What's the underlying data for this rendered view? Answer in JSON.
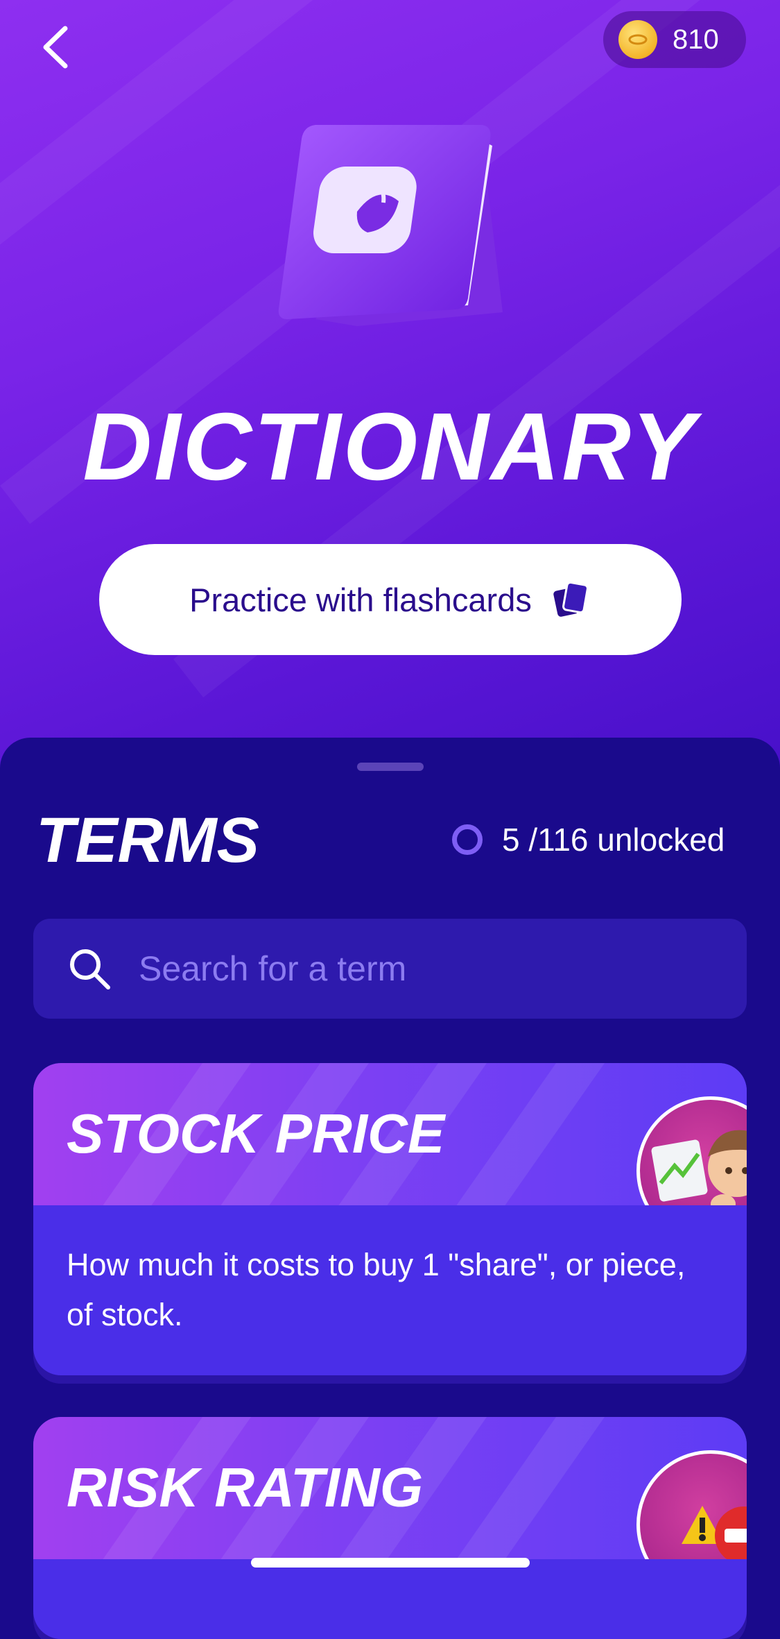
{
  "header": {
    "coins": "810",
    "title": "DICTIONARY",
    "flashcards_label": "Practice with flashcards"
  },
  "terms": {
    "title": "TERMS",
    "progress": "5 /116 unlocked",
    "progress_fraction": 0.043
  },
  "search": {
    "placeholder": "Search for a term"
  },
  "cards": [
    {
      "term": "STOCK PRICE",
      "definition": "How much it costs to buy 1 \"share\", or piece, of stock."
    },
    {
      "term": "RISK RATING",
      "definition": ""
    }
  ],
  "colors": {
    "hero_top": "#8e2ff0",
    "sheet": "#1a0a8c",
    "card": "#4a2ee8",
    "accent": "#7e5ef5"
  }
}
